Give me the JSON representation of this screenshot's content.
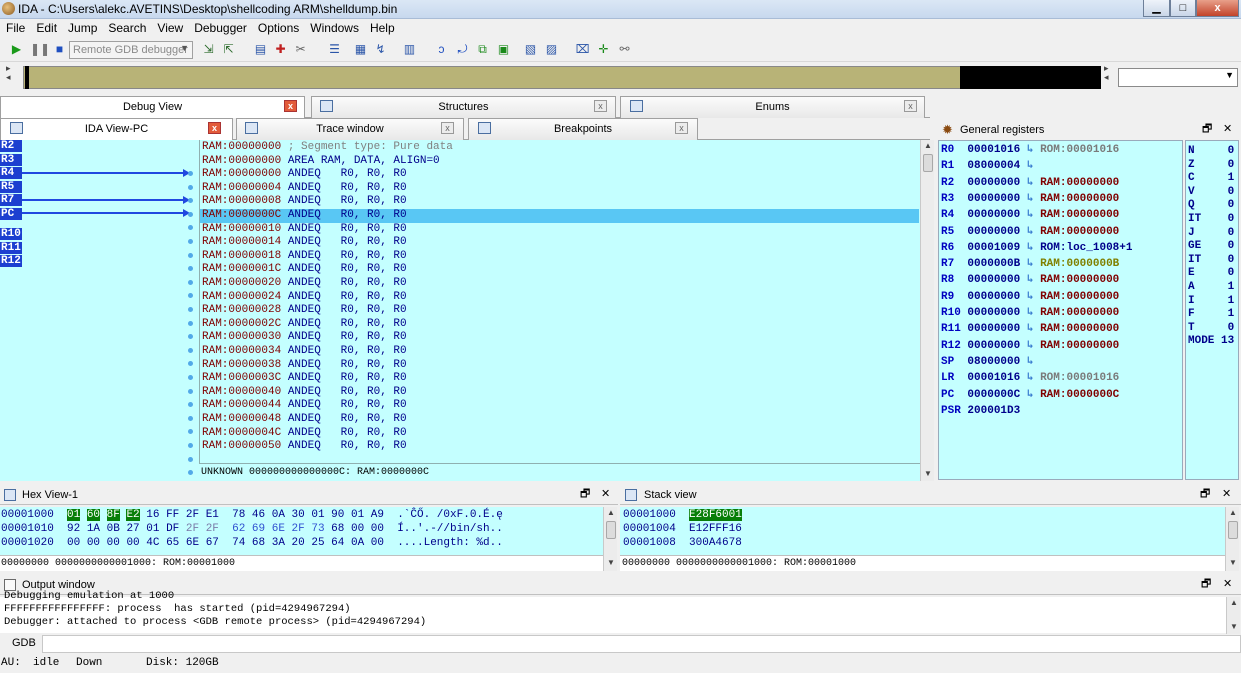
{
  "window": {
    "title": "IDA - C:\\Users\\alekc.AVETINS\\Desktop\\shellcoding ARM\\shelldump.bin",
    "minimize": "▁",
    "maximize": "□",
    "close": "x"
  },
  "menu": [
    "File",
    "Edit",
    "Jump",
    "Search",
    "View",
    "Debugger",
    "Options",
    "Windows",
    "Help"
  ],
  "toolbar": {
    "debugger_select": "Remote GDB debugger",
    "icons": [
      "play-icon",
      "pause-icon",
      "stop-icon",
      "attach-icon",
      "detach-icon",
      "breakpoint-list-icon",
      "add-breakpoint-icon",
      "delete-breakpoint-icon",
      "step-into-icon",
      "step-over-icon",
      "run-to-cursor-icon",
      "trace-icon",
      "step-until-return-icon",
      "loop-icon",
      "graph-icon",
      "registers-icon",
      "module-list-icon",
      "thread-list-icon",
      "trace-window-icon",
      "add-trace-icon",
      "clear-trace-icon"
    ]
  },
  "tabs_top": [
    {
      "label": "Debug View",
      "active": true
    },
    {
      "label": "Structures",
      "active": false
    },
    {
      "label": "Enums",
      "active": false
    }
  ],
  "tabs_inner": [
    {
      "label": "IDA View-PC",
      "active": true
    },
    {
      "label": "Trace window",
      "active": false
    },
    {
      "label": "Breakpoints",
      "active": false
    }
  ],
  "arrow_regs": [
    "R2",
    "R3",
    "R4",
    "R5",
    "R7",
    "PC",
    "R10",
    "R11",
    "R12"
  ],
  "disasm": [
    {
      "addr": "RAM:00000000",
      "text": " ; Segment type: Pure data",
      "type": "comment"
    },
    {
      "addr": "RAM:00000000",
      "text": " AREA RAM, DATA, ALIGN=0",
      "type": "directive"
    },
    {
      "addr": "RAM:00000000",
      "text": " ANDEQ   R0, R0, R0",
      "type": "insn"
    },
    {
      "addr": "RAM:00000004",
      "text": " ANDEQ   R0, R0, R0",
      "type": "insn"
    },
    {
      "addr": "RAM:00000008",
      "text": " ANDEQ   R0, R0, R0",
      "type": "insn"
    },
    {
      "addr": "RAM:0000000C",
      "text": " ANDEQ   R0, R0, R0",
      "type": "insn",
      "selected": true
    },
    {
      "addr": "RAM:00000010",
      "text": " ANDEQ   R0, R0, R0",
      "type": "insn"
    },
    {
      "addr": "RAM:00000014",
      "text": " ANDEQ   R0, R0, R0",
      "type": "insn"
    },
    {
      "addr": "RAM:00000018",
      "text": " ANDEQ   R0, R0, R0",
      "type": "insn"
    },
    {
      "addr": "RAM:0000001C",
      "text": " ANDEQ   R0, R0, R0",
      "type": "insn"
    },
    {
      "addr": "RAM:00000020",
      "text": " ANDEQ   R0, R0, R0",
      "type": "insn"
    },
    {
      "addr": "RAM:00000024",
      "text": " ANDEQ   R0, R0, R0",
      "type": "insn"
    },
    {
      "addr": "RAM:00000028",
      "text": " ANDEQ   R0, R0, R0",
      "type": "insn"
    },
    {
      "addr": "RAM:0000002C",
      "text": " ANDEQ   R0, R0, R0",
      "type": "insn"
    },
    {
      "addr": "RAM:00000030",
      "text": " ANDEQ   R0, R0, R0",
      "type": "insn"
    },
    {
      "addr": "RAM:00000034",
      "text": " ANDEQ   R0, R0, R0",
      "type": "insn"
    },
    {
      "addr": "RAM:00000038",
      "text": " ANDEQ   R0, R0, R0",
      "type": "insn"
    },
    {
      "addr": "RAM:0000003C",
      "text": " ANDEQ   R0, R0, R0",
      "type": "insn"
    },
    {
      "addr": "RAM:00000040",
      "text": " ANDEQ   R0, R0, R0",
      "type": "insn"
    },
    {
      "addr": "RAM:00000044",
      "text": " ANDEQ   R0, R0, R0",
      "type": "insn"
    },
    {
      "addr": "RAM:00000048",
      "text": " ANDEQ   R0, R0, R0",
      "type": "insn"
    },
    {
      "addr": "RAM:0000004C",
      "text": " ANDEQ   R0, R0, R0",
      "type": "insn"
    },
    {
      "addr": "RAM:00000050",
      "text": " ANDEQ   R0, R0, R0",
      "type": "insn"
    }
  ],
  "ida_status": "UNKNOWN 000000000000000C: RAM:0000000C",
  "registers_title": "General registers",
  "registers": [
    {
      "name": "R0",
      "value": "00001016",
      "target": "ROM:00001016",
      "tcolor": "grey"
    },
    {
      "name": "R1",
      "value": "08000004",
      "target": "",
      "tcolor": ""
    },
    {
      "name": "R2",
      "value": "00000000",
      "target": "RAM:00000000",
      "tcolor": "red"
    },
    {
      "name": "R3",
      "value": "00000000",
      "target": "RAM:00000000",
      "tcolor": "red"
    },
    {
      "name": "R4",
      "value": "00000000",
      "target": "RAM:00000000",
      "tcolor": "red"
    },
    {
      "name": "R5",
      "value": "00000000",
      "target": "RAM:00000000",
      "tcolor": "red"
    },
    {
      "name": "R6",
      "value": "00001009",
      "target": "ROM:loc_1008+1",
      "tcolor": "dark"
    },
    {
      "name": "R7",
      "value": "0000000B",
      "target": "RAM:0000000B",
      "tcolor": "olive"
    },
    {
      "name": "R8",
      "value": "00000000",
      "target": "RAM:00000000",
      "tcolor": "red"
    },
    {
      "name": "R9",
      "value": "00000000",
      "target": "RAM:00000000",
      "tcolor": "red"
    },
    {
      "name": "R10",
      "value": "00000000",
      "target": "RAM:00000000",
      "tcolor": "red"
    },
    {
      "name": "R11",
      "value": "00000000",
      "target": "RAM:00000000",
      "tcolor": "red"
    },
    {
      "name": "R12",
      "value": "00000000",
      "target": "RAM:00000000",
      "tcolor": "red"
    },
    {
      "name": "SP",
      "value": "08000000",
      "target": "",
      "tcolor": ""
    },
    {
      "name": "LR",
      "value": "00001016",
      "target": "ROM:00001016",
      "tcolor": "grey"
    },
    {
      "name": "PC",
      "value": "0000000C",
      "target": "RAM:0000000C",
      "tcolor": "red"
    },
    {
      "name": "PSR",
      "value": "200001D3",
      "target": "",
      "tcolor": "",
      "noarrow": true
    }
  ],
  "flags": [
    {
      "name": "N",
      "value": "0"
    },
    {
      "name": "Z",
      "value": "0"
    },
    {
      "name": "C",
      "value": "1"
    },
    {
      "name": "V",
      "value": "0"
    },
    {
      "name": "Q",
      "value": "0"
    },
    {
      "name": "IT",
      "value": "0"
    },
    {
      "name": "J",
      "value": "0"
    },
    {
      "name": "GE",
      "value": "0"
    },
    {
      "name": "IT",
      "value": "0"
    },
    {
      "name": "E",
      "value": "0"
    },
    {
      "name": "A",
      "value": "1"
    },
    {
      "name": "I",
      "value": "1"
    },
    {
      "name": "F",
      "value": "1"
    },
    {
      "name": "T",
      "value": "0"
    },
    {
      "name": "MODE",
      "value": "13"
    }
  ],
  "hex_view": {
    "title": "Hex View-1",
    "rows": [
      {
        "addr": "00001000",
        "bytes": [
          "01",
          "60",
          "8F",
          "E2",
          "16",
          "FF",
          "2F",
          "E1",
          "78",
          "46",
          "0A",
          "30",
          "01",
          "90",
          "01",
          "A9"
        ],
        "ascii": ".`ĈŐ. /0xF.0.É.ę"
      },
      {
        "addr": "00001010",
        "bytes": [
          "92",
          "1A",
          "0B",
          "27",
          "01",
          "DF",
          "2F",
          "2F",
          "62",
          "69",
          "6E",
          "2F",
          "73",
          "68",
          "00",
          "00"
        ],
        "ascii": "Í..'.-//bin/sh.."
      },
      {
        "addr": "00001020",
        "bytes": [
          "00",
          "00",
          "00",
          "00",
          "4C",
          "65",
          "6E",
          "67",
          "74",
          "68",
          "3A",
          "20",
          "25",
          "64",
          "0A",
          "00"
        ],
        "ascii": "....Length: %d.."
      }
    ],
    "status": "00000000 0000000000001000: ROM:00001000"
  },
  "stack_view": {
    "title": "Stack view",
    "rows": [
      {
        "addr": "00001000",
        "value": "E28F6001",
        "hl": true
      },
      {
        "addr": "00001004",
        "value": "E12FFF16",
        "hl": false
      },
      {
        "addr": "00001008",
        "value": "300A4678",
        "hl": false
      }
    ],
    "status": "00000000 0000000000001000: ROM:00001000"
  },
  "output": {
    "title": "Output window",
    "lines": [
      "Debugging emulation at 1000",
      "FFFFFFFFFFFFFFFF: process  has started (pid=4294967294)",
      "Debugger: attached to process <GDB remote process> (pid=4294967294)"
    ],
    "gdb_label": "GDB",
    "gdb_value": ""
  },
  "statusbar": {
    "au": "AU:",
    "state": "idle",
    "dir": "Down",
    "disk": "Disk: 120GB"
  }
}
